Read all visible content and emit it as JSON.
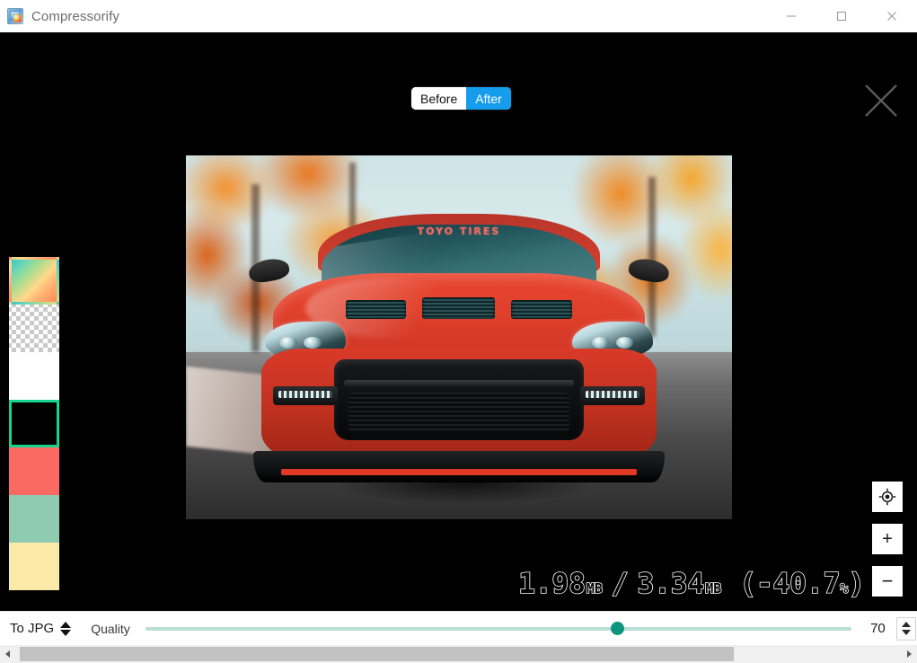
{
  "window": {
    "title": "Compressorify",
    "icon": "app-logo-icon",
    "controls": [
      {
        "name": "minimize",
        "glyph": "minimize-icon"
      },
      {
        "name": "maximize",
        "glyph": "maximize-icon"
      },
      {
        "name": "close",
        "glyph": "close-icon"
      }
    ]
  },
  "viewer": {
    "toggle": {
      "before_label": "Before",
      "after_label": "After",
      "active": "After",
      "active_color": "#159ced"
    },
    "close_label": "×",
    "image": {
      "alt": "Red Nissan GT-R sports car front view on a road with autumn trees",
      "windshield_banner": "TOYO TIRES"
    },
    "stats": {
      "compressed_size": "1.98",
      "compressed_unit": "MB",
      "separator": "/",
      "original_size": "3.34",
      "original_unit": "MB",
      "delta": "(-40.7",
      "delta_unit": "%",
      "delta_close": ")"
    },
    "zoom_controls": [
      {
        "name": "fit-to-screen",
        "label": "target-icon"
      },
      {
        "name": "zoom-in",
        "label": "+"
      },
      {
        "name": "zoom-out",
        "label": "−"
      }
    ],
    "swatches": [
      {
        "name": "gradient",
        "selected": false,
        "color": "gradient"
      },
      {
        "name": "transparent",
        "selected": false,
        "color": "checkerboard"
      },
      {
        "name": "white",
        "selected": false,
        "color": "#ffffff"
      },
      {
        "name": "black",
        "selected": true,
        "color": "#000000"
      },
      {
        "name": "red",
        "selected": false,
        "color": "#fa6a63"
      },
      {
        "name": "green",
        "selected": false,
        "color": "#8fcbb0"
      },
      {
        "name": "yellow",
        "selected": false,
        "color": "#fae9a8"
      }
    ],
    "selection_color": "#16d48d"
  },
  "toolbar": {
    "format_label": "To JPG",
    "quality_label": "Quality",
    "quality_value": "70",
    "slider": {
      "min": 0,
      "max": 100,
      "value": 70,
      "thumb_color": "#0f9480",
      "track_color": "#b9ded6"
    }
  },
  "scrollbar": {
    "orientation": "horizontal",
    "left_arrow": "◀",
    "right_arrow": "▶"
  }
}
